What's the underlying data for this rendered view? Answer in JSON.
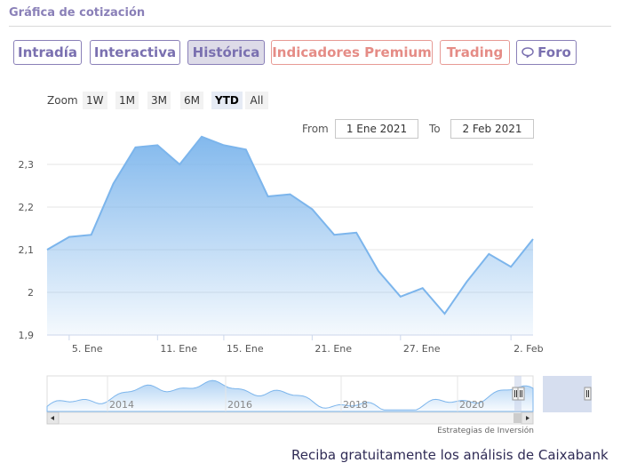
{
  "section_title": "Gráfica de cotización",
  "tabs": [
    {
      "label": "Intradía",
      "active": false,
      "style": "normal"
    },
    {
      "label": "Interactiva",
      "active": false,
      "style": "normal"
    },
    {
      "label": "Histórica",
      "active": true,
      "style": "normal"
    },
    {
      "label": "Indicadores Premium",
      "active": false,
      "style": "premium"
    },
    {
      "label": "Trading",
      "active": false,
      "style": "premium"
    },
    {
      "label": "Foro",
      "active": false,
      "style": "normal",
      "icon": "chat-bubble-icon"
    }
  ],
  "zoom": {
    "label": "Zoom",
    "buttons": [
      "1W",
      "1M",
      "3M",
      "6M",
      "YTD",
      "All"
    ],
    "selected": "YTD"
  },
  "range": {
    "from_label": "From",
    "from_value": "1 Ene 2021",
    "to_label": "To",
    "to_value": "2 Feb 2021"
  },
  "colors": {
    "accent": "#8a80b8",
    "premium": "#e58c86",
    "line": "#7cb5ec",
    "navigator_mask": "#ccd6eb"
  },
  "chart_data": {
    "type": "area",
    "x": [
      "2021-01-04",
      "2021-01-05",
      "2021-01-06",
      "2021-01-07",
      "2021-01-08",
      "2021-01-11",
      "2021-01-12",
      "2021-01-13",
      "2021-01-14",
      "2021-01-15",
      "2021-01-18",
      "2021-01-19",
      "2021-01-20",
      "2021-01-21",
      "2021-01-22",
      "2021-01-25",
      "2021-01-26",
      "2021-01-27",
      "2021-01-28",
      "2021-01-29",
      "2021-02-01",
      "2021-02-02"
    ],
    "values": [
      2.1,
      2.13,
      2.135,
      2.255,
      2.34,
      2.345,
      2.3,
      2.365,
      2.345,
      2.335,
      2.225,
      2.23,
      2.195,
      2.135,
      2.14,
      2.05,
      1.99,
      2.01,
      1.95,
      2.025,
      2.09,
      2.06,
      2.125
    ],
    "x_tick_labels": [
      "5. Ene",
      "11. Ene",
      "15. Ene",
      "21. Ene",
      "27. Ene",
      "2. Feb"
    ],
    "y_tick_labels": [
      "1,9",
      "2",
      "2,1",
      "2,2",
      "2,3"
    ],
    "y_ticks": [
      1.9,
      2.0,
      2.1,
      2.2,
      2.3
    ],
    "ylim": [
      1.9,
      2.4
    ],
    "grid": true,
    "navigator": {
      "year_labels": [
        "2014",
        "2016",
        "2018",
        "2020"
      ]
    },
    "credits": "Estrategias de Inversión"
  },
  "footer": "Reciba gratuitamente los análisis de Caixabank"
}
